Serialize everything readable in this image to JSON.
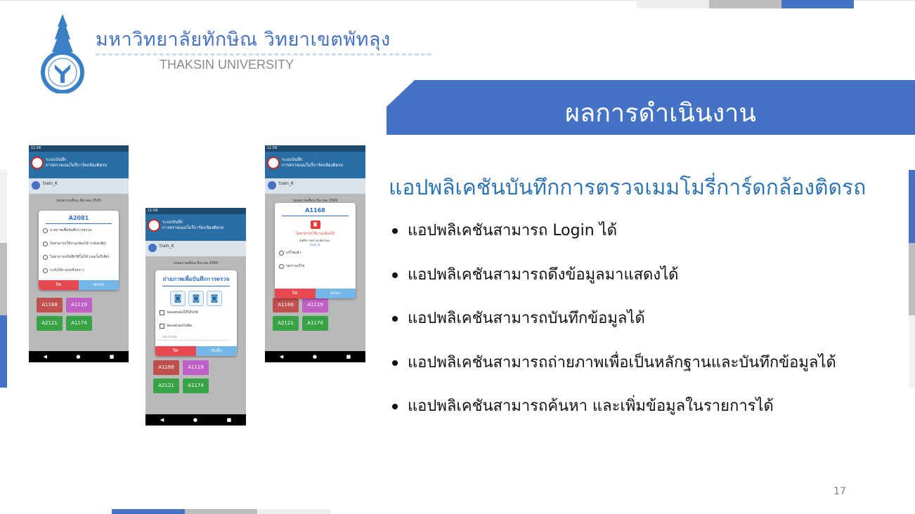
{
  "header": {
    "university_thai": "มหาวิทยาลัยทักษิณ วิทยาเขตพัทลุง",
    "university_english": "THAKSIN UNIVERSITY"
  },
  "title": "ผลการดำเนินงาน",
  "subtitle": "แอปพลิเคชันบันทึกการตรวจเมมโมรี่การ์ดกล้องติดรถ",
  "bullets": [
    "แอปพลิเคชันสามารถ Login ได้",
    "แอปพลิเคชันสามารถดึงข้อมูลมาแสดงได้",
    "แอปพลิเคชันสามารถบันทึกข้อมูลได้",
    "แอปพลิเคชันสามารถถ่ายภาพเพื่อเป็นหลักฐานและบันทึกข้อมูลได้",
    "แอปพลิเคชันสามารถค้นหา และเพิ่มข้อมูลในรายการได้"
  ],
  "page_number": "17",
  "colors": {
    "accent": "#4472c4",
    "subtitle": "#2e74b5",
    "gray": "#bdbdbd"
  },
  "phones": {
    "status_time": "11:56",
    "app_title_line1": "ระบบบันทึก",
    "app_title_line2": "การตรวจเมมโมรี่การ์ดกล้องติดรถ",
    "username": "train_K",
    "month_label": "รอบตรวจเดือน มีนาคม 2565",
    "tiles": [
      "A1168",
      "A1119",
      "A2121",
      "A1174"
    ],
    "nav": [
      "◀",
      "●",
      "■"
    ],
    "phone1": {
      "dialog_title": "A2081",
      "options": [
        "ถ่ายภาพเพื่อบันทึกการตรวจ",
        "ไม่สามารถใช้งานกล้องได้ (กล้องเสีย)",
        "ไม่สามารถบันทึกวิดีโอได้ (เมมโมรี่เสีย)",
        "ระงับใช้งานรถชั่วคราว"
      ],
      "cancel": "ปิด",
      "ok": "ตกลง"
    },
    "phone2": {
      "dialog_title": "ถ่ายภาพเพื่อบันทึกการตรวจ",
      "checks": [
        "จอแสดงผลใช้ได้ปกติ",
        "จอแสดงผลไม่ติด"
      ],
      "note_placeholder": "หมายเหตุ",
      "cancel": "ปิด",
      "save": "บันทึก"
    },
    "phone3": {
      "dialog_title": "A1168",
      "error_text": "ไม่สามารถใช้งานกล้องได้",
      "recorded_by": "บันทึกการตรวจกล้องโดย :",
      "recorded_user": "train_K",
      "options": [
        "แก้ไขแล้ว",
        "รอการแก้ไข"
      ],
      "cancel": "ปิด",
      "ok": "ตกลง"
    }
  }
}
